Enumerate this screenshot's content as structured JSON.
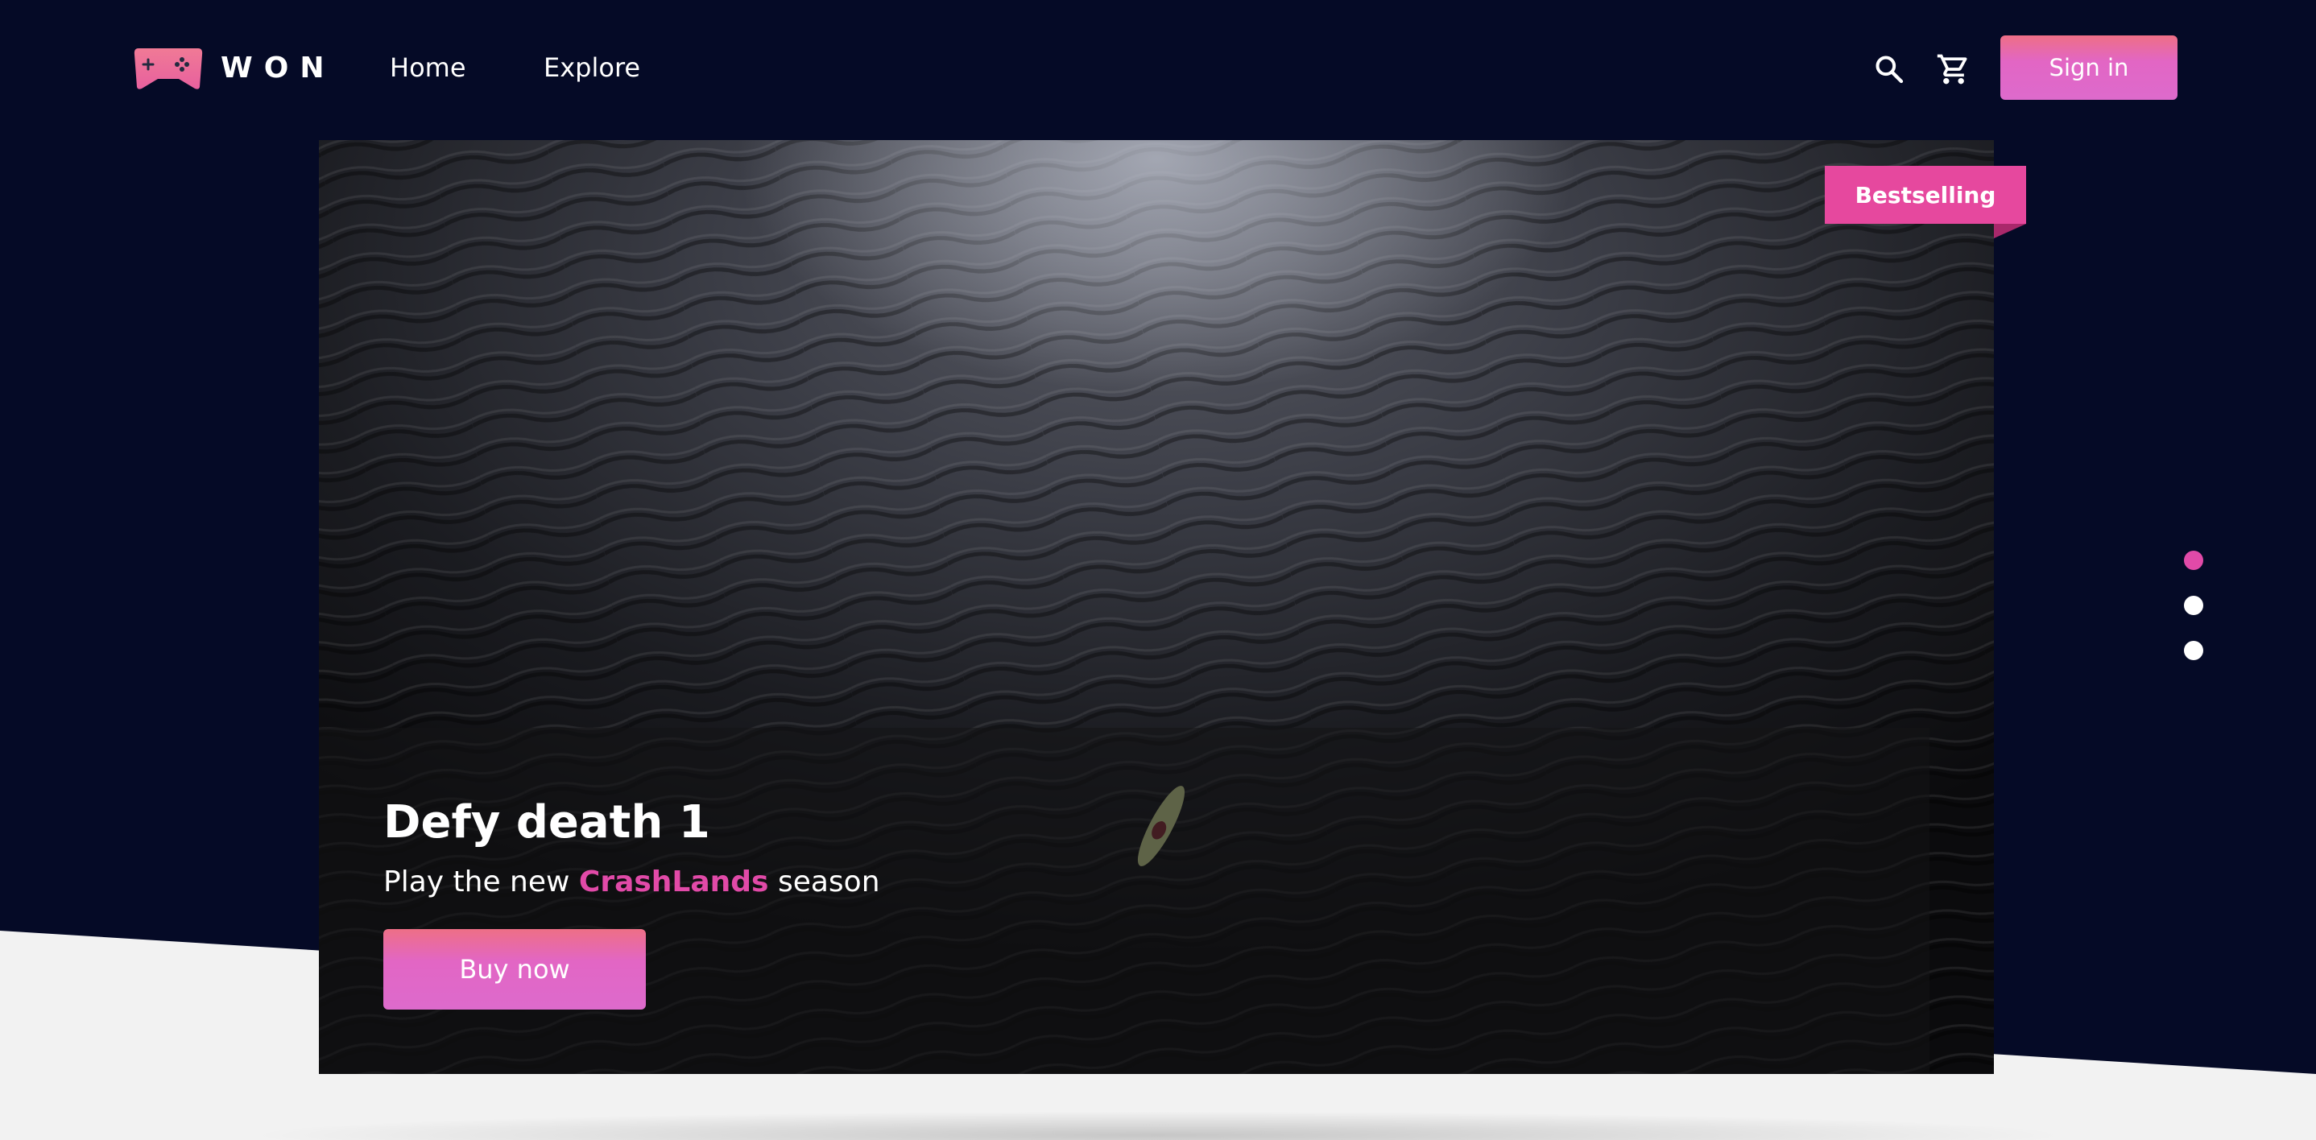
{
  "app": {
    "logo_text": "WON",
    "logo_icon": "gamepad-icon"
  },
  "nav": {
    "links": [
      {
        "label": "Home"
      },
      {
        "label": "Explore"
      }
    ],
    "search_icon": "search-icon",
    "cart_icon": "shopping-cart-icon",
    "signin_label": "Sign in"
  },
  "hero": {
    "badge": "Bestselling",
    "title": "Defy death 1",
    "subtitle_prefix": "Play the new ",
    "subtitle_highlight": "CrashLands",
    "subtitle_suffix": " season",
    "cta_label": "Buy now"
  },
  "carousel": {
    "slides_count": 3,
    "active_index": 0
  },
  "colors": {
    "background": "#050a26",
    "accent": "#e14aa8",
    "button_gradient_top": "#ee6f86",
    "button_gradient_bottom": "#dd6acc",
    "floor": "#f2f2f2"
  }
}
